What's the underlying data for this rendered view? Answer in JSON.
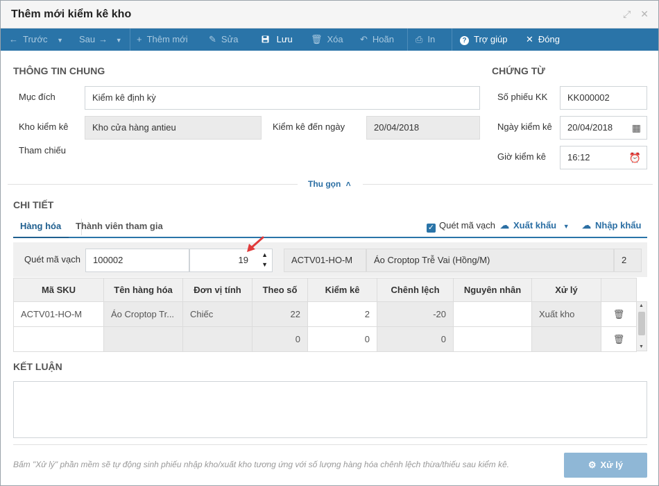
{
  "window": {
    "title": "Thêm mới kiểm kê kho",
    "expand_icon": "expand-icon",
    "close_icon": "close-icon"
  },
  "toolbar": {
    "prev": "Trước",
    "next": "Sau",
    "add": "Thêm mới",
    "edit": "Sửa",
    "save": "Lưu",
    "delete": "Xóa",
    "undo": "Hoãn",
    "print": "In",
    "help": "Trợ giúp",
    "close": "Đóng"
  },
  "general": {
    "heading": "THÔNG TIN CHUNG",
    "purpose_label": "Mục đích",
    "purpose_value": "Kiểm kê định kỳ",
    "warehouse_label": "Kho kiểm kê",
    "warehouse_value": "Kho cửa hàng antieu",
    "to_date_label": "Kiểm kê đến ngày",
    "to_date_value": "20/04/2018",
    "reference_label": "Tham chiếu"
  },
  "voucher": {
    "heading": "CHỨNG TỪ",
    "number_label": "Số phiếu KK",
    "number_value": "KK000002",
    "date_label": "Ngày kiểm kê",
    "date_value": "20/04/2018",
    "time_label": "Giờ kiểm kê",
    "time_value": "16:12"
  },
  "collapse_label": "Thu gọn",
  "detail": {
    "heading": "CHI TIẾT",
    "tabs": [
      "Hàng hóa",
      "Thành viên tham gia"
    ],
    "scan_checkbox_label": "Quét mã vạch",
    "export_label": "Xuất khẩu",
    "import_label": "Nhập khẩu",
    "scan": {
      "label": "Quét mã vạch",
      "barcode": "100002",
      "quantity": "19",
      "sku": "ACTV01-HO-M",
      "name": "Áo Croptop Trễ Vai (Hồng/M)",
      "count": "2"
    },
    "columns": [
      "Mã SKU",
      "Tên hàng hóa",
      "Đơn vị tính",
      "Theo số",
      "Kiểm kê",
      "Chênh lệch",
      "Nguyên nhân",
      "Xử lý"
    ],
    "rows": [
      {
        "sku": "ACTV01-HO-M",
        "name": "Áo Croptop Tr...",
        "unit": "Chiếc",
        "book": "22",
        "counted": "2",
        "diff": "-20",
        "reason": "",
        "action": "Xuất kho"
      },
      {
        "sku": "",
        "name": "",
        "unit": "",
        "book": "0",
        "counted": "0",
        "diff": "0",
        "reason": "",
        "action": ""
      }
    ]
  },
  "conclusion": {
    "heading": "KẾT LUẬN"
  },
  "footer": {
    "hint": "Bấm \"Xử lý\" phần mềm sẽ tự động sinh phiếu nhập kho/xuất kho tương ứng với số lượng hàng hóa chênh lệch thừa/thiếu sau kiểm kê.",
    "process_button": "Xử lý"
  },
  "colors": {
    "toolbar": "#2a74a8",
    "accent": "#1f5f8f",
    "delete": "#d43232",
    "arrow": "#e03a3a"
  }
}
